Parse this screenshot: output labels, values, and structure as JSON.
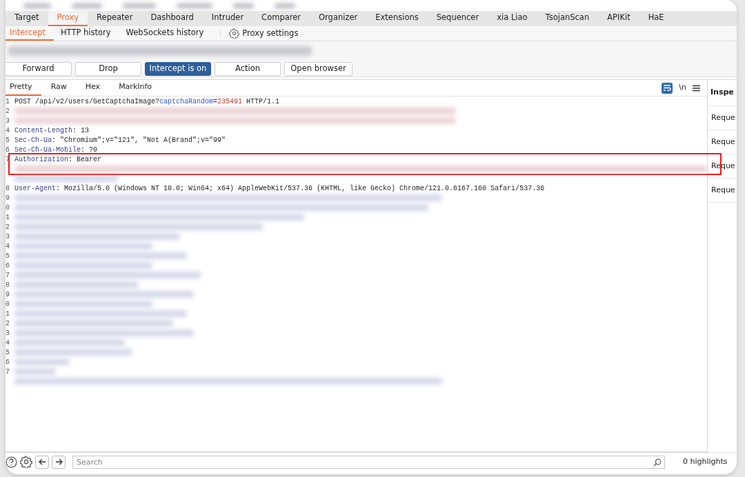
{
  "tabs": [
    {
      "label": "Target",
      "selected": false
    },
    {
      "label": "Proxy",
      "selected": true
    },
    {
      "label": "Repeater",
      "selected": false
    },
    {
      "label": "Dashboard",
      "selected": false
    },
    {
      "label": "Intruder",
      "selected": false
    },
    {
      "label": "Comparer",
      "selected": false
    },
    {
      "label": "Organizer",
      "selected": false
    },
    {
      "label": "Extensions",
      "selected": false
    },
    {
      "label": "Sequencer",
      "selected": false
    },
    {
      "label": "xia Liao",
      "selected": false
    },
    {
      "label": "TsojanScan",
      "selected": false
    },
    {
      "label": "APIKit",
      "selected": false
    },
    {
      "label": "HaE",
      "selected": false
    }
  ],
  "subtabs": [
    {
      "label": "Intercept",
      "selected": true
    },
    {
      "label": "HTTP history",
      "selected": false
    },
    {
      "label": "WebSockets history",
      "selected": false
    }
  ],
  "proxy_settings": {
    "label": "Proxy settings"
  },
  "buttons": [
    {
      "label": "Forward",
      "on": false
    },
    {
      "label": "Drop",
      "on": false
    },
    {
      "label": "Intercept is on",
      "on": true
    },
    {
      "label": "Action",
      "on": false
    },
    {
      "label": "Open browser",
      "on": false
    }
  ],
  "editor": {
    "tabs": [
      {
        "label": "Pretty",
        "selected": true
      },
      {
        "label": "Raw",
        "selected": false
      },
      {
        "label": "Hex",
        "selected": false
      },
      {
        "label": "MarkInfo",
        "selected": false
      }
    ],
    "wrap_on": true,
    "newline_label": "\\n",
    "lines": [
      {
        "kind": "code",
        "number": "1",
        "segments": [
          {
            "kind": "plain",
            "text": "POST /api/v2/users/GetCaptchaImage?"
          },
          {
            "kind": "param",
            "text": "captchaRandom"
          },
          {
            "kind": "plain",
            "text": "="
          },
          {
            "kind": "number",
            "text": "235491"
          },
          {
            "kind": "plain",
            "text": " HTTP/1.1"
          }
        ]
      },
      {
        "kind": "redacted",
        "number": "2"
      },
      {
        "kind": "redacted",
        "number": "3"
      },
      {
        "kind": "code",
        "number": "4",
        "segments": [
          {
            "kind": "header",
            "text": "Content-Length"
          },
          {
            "kind": "plain",
            "text": ": 13"
          }
        ]
      },
      {
        "kind": "code",
        "number": "5",
        "segments": [
          {
            "kind": "header",
            "text": "Sec-Ch-Ua"
          },
          {
            "kind": "plain",
            "text": ": \"Chromium\";v=\"121\", \"Not A(Brand\";v=\"99\""
          }
        ]
      },
      {
        "kind": "code",
        "number": "6",
        "segments": [
          {
            "kind": "header",
            "text": "Sec-Ch-Ua-Mobile"
          },
          {
            "kind": "plain",
            "text": ": ?0"
          }
        ]
      },
      {
        "kind": "highlight",
        "lines": [
          {
            "kind": "code",
            "number": "7",
            "segments": [
              {
                "kind": "header",
                "text": "Authorization"
              },
              {
                "kind": "plain",
                "text": ": Bearer"
              }
            ]
          },
          {
            "kind": "redacted"
          }
        ]
      },
      {
        "kind": "redacted"
      },
      {
        "kind": "code",
        "number": "8",
        "segments": [
          {
            "kind": "header",
            "text": "User-Agent"
          },
          {
            "kind": "plain",
            "text": ": Mozilla/5.0 (Windows NT 10.0; Win64; x64) AppleWebKit/537.36 (KHTML, like Gecko) Chrome/121.0.6167.160 Safari/537.36"
          }
        ]
      },
      {
        "kind": "redacted",
        "number": "9"
      },
      {
        "kind": "redacted",
        "number": "0"
      },
      {
        "kind": "redacted",
        "number": "1"
      },
      {
        "kind": "redacted",
        "number": "2"
      },
      {
        "kind": "redacted",
        "number": "3"
      },
      {
        "kind": "redacted",
        "number": "4"
      },
      {
        "kind": "redacted",
        "number": "5"
      },
      {
        "kind": "redacted",
        "number": "6"
      },
      {
        "kind": "redacted",
        "number": "7"
      },
      {
        "kind": "redacted",
        "number": "8"
      },
      {
        "kind": "redacted",
        "number": "9"
      },
      {
        "kind": "redacted",
        "number": "0"
      },
      {
        "kind": "redacted",
        "number": "1"
      },
      {
        "kind": "redacted",
        "number": "2"
      },
      {
        "kind": "redacted",
        "number": "3"
      },
      {
        "kind": "redacted",
        "number": "4"
      },
      {
        "kind": "redacted",
        "number": "5"
      },
      {
        "kind": "redacted",
        "number": "6"
      },
      {
        "kind": "redacted",
        "number": "7"
      },
      {
        "kind": "redacted"
      }
    ]
  },
  "inspector": {
    "title": "Inspe",
    "items": [
      "Reque",
      "Reque",
      "Reque",
      "Reque"
    ]
  },
  "footer": {
    "search_placeholder": "Search",
    "highlights": "0 highlights"
  }
}
